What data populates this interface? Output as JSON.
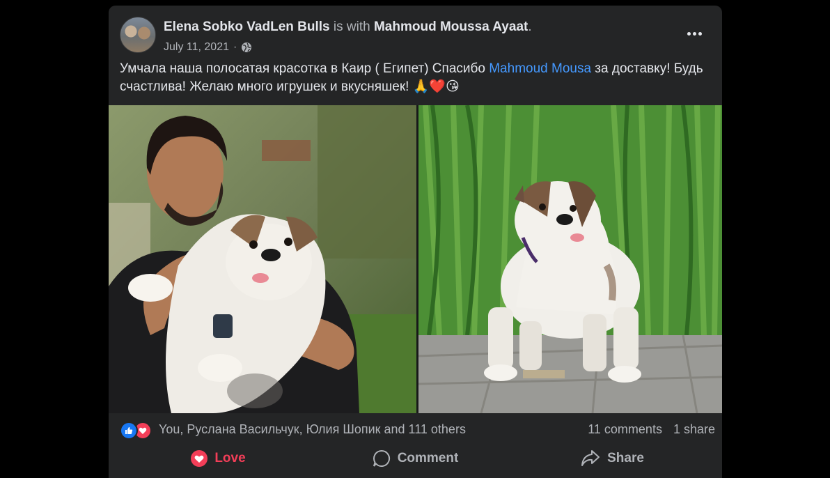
{
  "post": {
    "author": "Elena Sobko VadLen Bulls",
    "with_text": "is with",
    "tagged": "Mahmoud Moussa Ayaat",
    "tagged_suffix": ".",
    "date": "July 11, 2021",
    "date_separator": "·",
    "privacy_icon": "globe-icon",
    "menu_icon": "more-options-icon",
    "text_part1": "Умчала наша полосатая красотка в Каир ( Египет) Спасибо ",
    "mention": "Mahmoud Mousa",
    "text_part2": " за доставку! Будь счастлива! Желаю много игрушек и вкусняшек! 🙏❤️😘"
  },
  "reactions": {
    "reactors_text": "You, Руслана Васильчук, Юлия Шопик and 111 others",
    "comments": "11 comments",
    "shares": "1 share"
  },
  "actions": {
    "love_label": "Love",
    "comment_label": "Comment",
    "share_label": "Share"
  },
  "colors": {
    "background": "#000000",
    "card": "#242526",
    "text": "#e4e6eb",
    "muted": "#b0b3b8",
    "link": "#4599ff",
    "like_blue": "#1877f2",
    "love_red": "#f33e58"
  }
}
